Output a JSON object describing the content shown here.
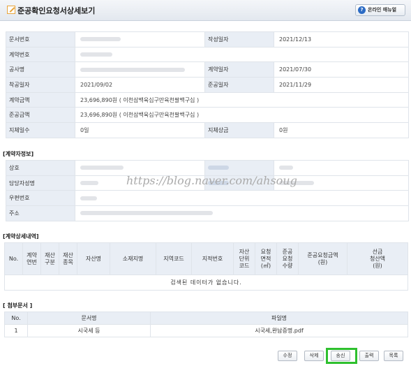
{
  "window": {
    "title": "준공확인요청서상세보기",
    "manual_label": "온라인 매뉴얼",
    "help_glyph": "?",
    "accent_color": "#2c6bc4",
    "highlight_color": "#2ec02e"
  },
  "doc_info": {
    "doc_no_label": "문서번호",
    "written_date_label": "작성일자",
    "written_date": "2021/12/13",
    "contract_no_label": "계약번호",
    "project_label": "공사명",
    "contract_date_label": "계약일자",
    "contract_date": "2021/07/30",
    "start_date_label": "착공일자",
    "start_date": "2021/09/02",
    "completion_date_label": "준공일자",
    "completion_date": "2021/11/29",
    "contract_amount_label": "계약금액",
    "contract_amount": "23,696,890원 ( 이천삼백육십구만육천팔백구십 )",
    "completion_amount_label": "준공금액",
    "completion_amount": "23,696,890원 ( 이천삼백육십구만육천팔백구십 )",
    "delay_days_label": "지체일수",
    "delay_days": "0일",
    "delay_penalty_label": "지체상금",
    "delay_penalty": "0원"
  },
  "contractor": {
    "section_title": "[계약자정보]",
    "company_label": "상호",
    "manager_label": "담당자성명",
    "postcode_label": "우편번호",
    "address_label": "주소"
  },
  "watermark": "https://blog.naver.com/ahsoug",
  "contract_detail": {
    "section_title": "[계약상세내역]",
    "columns": [
      "No.",
      "계약\n연번",
      "재산\n구분",
      "재산\n종목",
      "자산명",
      "소재지명",
      "지역코드",
      "지적번호",
      "자산\n단위\n코드",
      "요청\n면적\n(㎡)",
      "준공\n요청\n수량",
      "준공요청금액\n(원)",
      "선금\n청산액\n(원)"
    ],
    "no_data": "검색된 데이터가 없습니다."
  },
  "attachments": {
    "section_title": "[ 첨부문서 ]",
    "col_no": "No.",
    "col_doc": "문서명",
    "col_file": "파일명",
    "rows": [
      {
        "no": "1",
        "doc": "시국세 등",
        "file": "시국세,완납증명.pdf"
      }
    ]
  },
  "buttons": {
    "edit": "수정",
    "delete": "삭제",
    "send": "송신",
    "print": "출력",
    "list": "목록"
  }
}
